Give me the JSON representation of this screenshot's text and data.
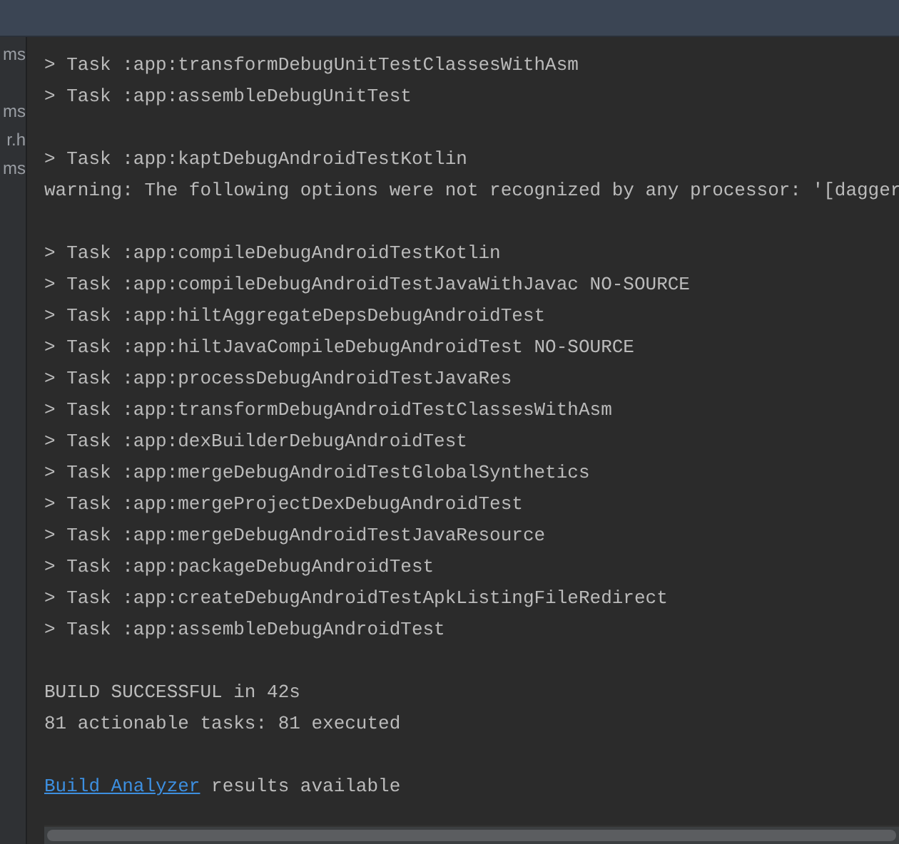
{
  "side_panel": {
    "items": [
      {
        "kind": "text",
        "text": "ms"
      },
      {
        "kind": "blank"
      },
      {
        "kind": "text",
        "text": "ms"
      },
      {
        "kind": "text",
        "text": "r.h"
      },
      {
        "kind": "text",
        "text": "ms"
      }
    ]
  },
  "console": {
    "lines": [
      {
        "kind": "text",
        "text": "> Task :app:transformDebugUnitTestClassesWithAsm"
      },
      {
        "kind": "text",
        "text": "> Task :app:assembleDebugUnitTest"
      },
      {
        "kind": "blank"
      },
      {
        "kind": "text",
        "text": "> Task :app:kaptDebugAndroidTestKotlin"
      },
      {
        "kind": "text",
        "text": "warning: The following options were not recognized by any processor: '[dagger"
      },
      {
        "kind": "blank"
      },
      {
        "kind": "text",
        "text": "> Task :app:compileDebugAndroidTestKotlin"
      },
      {
        "kind": "text",
        "text": "> Task :app:compileDebugAndroidTestJavaWithJavac NO-SOURCE"
      },
      {
        "kind": "text",
        "text": "> Task :app:hiltAggregateDepsDebugAndroidTest"
      },
      {
        "kind": "text",
        "text": "> Task :app:hiltJavaCompileDebugAndroidTest NO-SOURCE"
      },
      {
        "kind": "text",
        "text": "> Task :app:processDebugAndroidTestJavaRes"
      },
      {
        "kind": "text",
        "text": "> Task :app:transformDebugAndroidTestClassesWithAsm"
      },
      {
        "kind": "text",
        "text": "> Task :app:dexBuilderDebugAndroidTest"
      },
      {
        "kind": "text",
        "text": "> Task :app:mergeDebugAndroidTestGlobalSynthetics"
      },
      {
        "kind": "text",
        "text": "> Task :app:mergeProjectDexDebugAndroidTest"
      },
      {
        "kind": "text",
        "text": "> Task :app:mergeDebugAndroidTestJavaResource"
      },
      {
        "kind": "text",
        "text": "> Task :app:packageDebugAndroidTest"
      },
      {
        "kind": "text",
        "text": "> Task :app:createDebugAndroidTestApkListingFileRedirect"
      },
      {
        "kind": "text",
        "text": "> Task :app:assembleDebugAndroidTest"
      },
      {
        "kind": "blank"
      },
      {
        "kind": "text",
        "text": "BUILD SUCCESSFUL in 42s"
      },
      {
        "kind": "text",
        "text": "81 actionable tasks: 81 executed"
      },
      {
        "kind": "blank"
      },
      {
        "kind": "link",
        "link": "Build Analyzer",
        "text": "results available"
      }
    ]
  }
}
